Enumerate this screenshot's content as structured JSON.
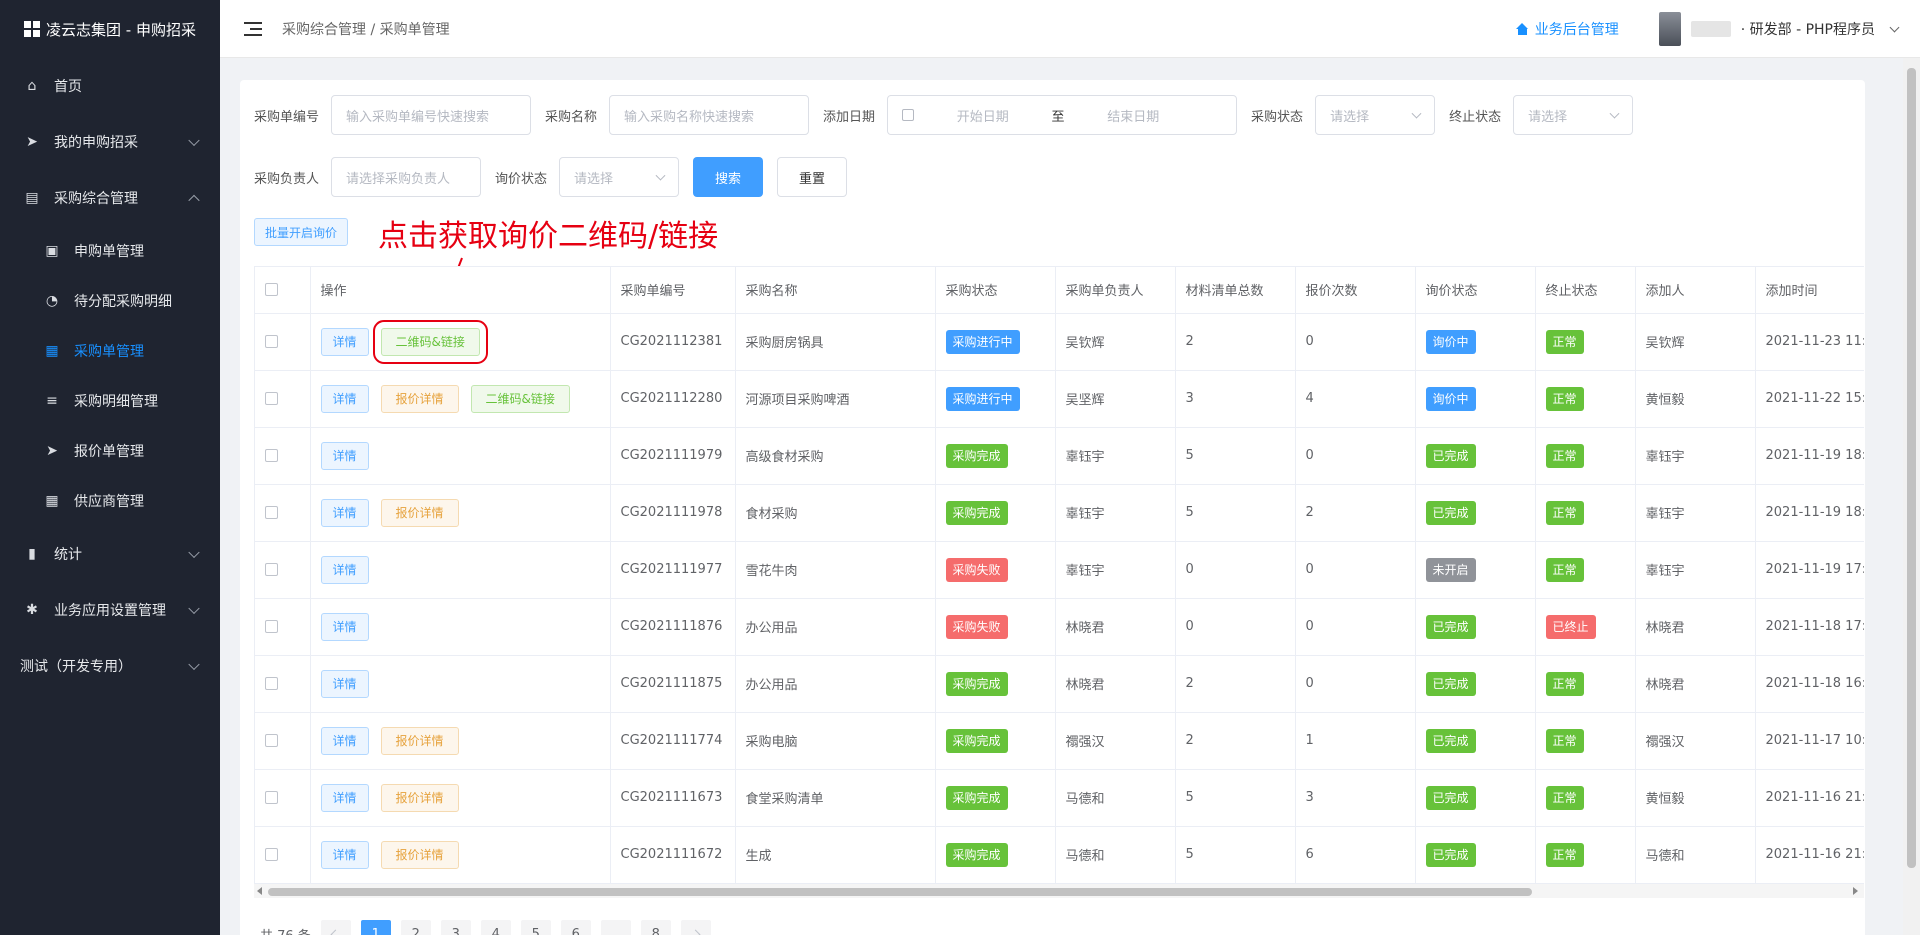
{
  "brand": {
    "title": "凌云志集团 - 申购招采"
  },
  "sidebar": {
    "items": [
      {
        "label": "首页",
        "icon": "home-icon",
        "arrow": ""
      },
      {
        "label": "我的申购招采",
        "icon": "send-icon",
        "arrow": "down"
      },
      {
        "label": "采购综合管理",
        "icon": "chart-icon",
        "arrow": "up"
      }
    ],
    "submenu": [
      {
        "label": "申购单管理",
        "icon": "clipboard-icon",
        "active": false
      },
      {
        "label": "待分配采购明细",
        "icon": "clock-icon",
        "active": false
      },
      {
        "label": "采购单管理",
        "icon": "document-icon",
        "active": true
      },
      {
        "label": "采购明细管理",
        "icon": "sliders-icon",
        "active": false
      },
      {
        "label": "报价单管理",
        "icon": "send-icon",
        "active": false
      },
      {
        "label": "供应商管理",
        "icon": "grid-icon",
        "active": false
      }
    ],
    "items2": [
      {
        "label": "统计",
        "icon": "bar-chart-icon"
      },
      {
        "label": "业务应用设置管理",
        "icon": "gear-icon"
      },
      {
        "label": "测试（开发专用）",
        "icon": ""
      }
    ]
  },
  "header": {
    "breadcrumb": "采购综合管理 / 采购单管理",
    "biz_link": "业务后台管理",
    "user_text": "· 研发部 - PHP程序员"
  },
  "filters": {
    "order_no_label": "采购单编号",
    "order_no_placeholder": "输入采购单编号快速搜索",
    "name_label": "采购名称",
    "name_placeholder": "输入采购名称快速搜索",
    "date_label": "添加日期",
    "date_start": "开始日期",
    "date_sep": "至",
    "date_end": "结束日期",
    "status_label": "采购状态",
    "status_placeholder": "请选择",
    "terminate_label": "终止状态",
    "terminate_placeholder": "请选择",
    "owner_label": "采购负责人",
    "owner_placeholder": "请选择采购负责人",
    "inquiry_label": "询价状态",
    "inquiry_placeholder": "请选择",
    "search_btn": "搜索",
    "reset_btn": "重置",
    "batch_btn": "批量开启询价"
  },
  "annotation": "点击获取询价二维码/链接",
  "table": {
    "headers": [
      "操作",
      "采购单编号",
      "采购名称",
      "采购状态",
      "采购单负责人",
      "材料清单总数",
      "报价次数",
      "询价状态",
      "终止状态",
      "添加人",
      "添加时间"
    ],
    "action_labels": {
      "detail": "详情",
      "quote": "报价详情",
      "qr": "二维码&链接"
    },
    "rows": [
      {
        "actions": [
          "detail",
          "qr"
        ],
        "no": "CG2021112381",
        "name": "采购厨房锅具",
        "status": "采购进行中",
        "status_color": "blue",
        "owner": "吴钦辉",
        "materials": "2",
        "quotes": "0",
        "inquiry": "询价中",
        "inquiry_color": "blue",
        "terminate": "正常",
        "terminate_color": "green",
        "adder": "吴钦辉",
        "time": "2021-11-23 11:"
      },
      {
        "actions": [
          "detail",
          "quote",
          "qr"
        ],
        "no": "CG2021112280",
        "name": "河源项目采购啤酒",
        "status": "采购进行中",
        "status_color": "blue",
        "owner": "吴坚辉",
        "materials": "3",
        "quotes": "4",
        "inquiry": "询价中",
        "inquiry_color": "blue",
        "terminate": "正常",
        "terminate_color": "green",
        "adder": "黄恒毅",
        "time": "2021-11-22 15:"
      },
      {
        "actions": [
          "detail"
        ],
        "no": "CG2021111979",
        "name": "高级食材采购",
        "status": "采购完成",
        "status_color": "green",
        "owner": "辜钰宇",
        "materials": "5",
        "quotes": "0",
        "inquiry": "已完成",
        "inquiry_color": "green",
        "terminate": "正常",
        "terminate_color": "green",
        "adder": "辜钰宇",
        "time": "2021-11-19 18:"
      },
      {
        "actions": [
          "detail",
          "quote"
        ],
        "no": "CG2021111978",
        "name": "食材采购",
        "status": "采购完成",
        "status_color": "green",
        "owner": "辜钰宇",
        "materials": "5",
        "quotes": "2",
        "inquiry": "已完成",
        "inquiry_color": "green",
        "terminate": "正常",
        "terminate_color": "green",
        "adder": "辜钰宇",
        "time": "2021-11-19 18:"
      },
      {
        "actions": [
          "detail"
        ],
        "no": "CG2021111977",
        "name": "雪花牛肉",
        "status": "采购失败",
        "status_color": "red",
        "owner": "辜钰宇",
        "materials": "0",
        "quotes": "0",
        "inquiry": "未开启",
        "inquiry_color": "gray",
        "terminate": "正常",
        "terminate_color": "green",
        "adder": "辜钰宇",
        "time": "2021-11-19 17:"
      },
      {
        "actions": [
          "detail"
        ],
        "no": "CG2021111876",
        "name": "办公用品",
        "status": "采购失败",
        "status_color": "red",
        "owner": "林晓君",
        "materials": "0",
        "quotes": "0",
        "inquiry": "已完成",
        "inquiry_color": "green",
        "terminate": "已终止",
        "terminate_color": "red",
        "adder": "林晓君",
        "time": "2021-11-18 17:"
      },
      {
        "actions": [
          "detail"
        ],
        "no": "CG2021111875",
        "name": "办公用品",
        "status": "采购完成",
        "status_color": "green",
        "owner": "林晓君",
        "materials": "2",
        "quotes": "0",
        "inquiry": "已完成",
        "inquiry_color": "green",
        "terminate": "正常",
        "terminate_color": "green",
        "adder": "林晓君",
        "time": "2021-11-18 16:"
      },
      {
        "actions": [
          "detail",
          "quote"
        ],
        "no": "CG2021111774",
        "name": "采购电脑",
        "status": "采购完成",
        "status_color": "green",
        "owner": "禤强汉",
        "materials": "2",
        "quotes": "1",
        "inquiry": "已完成",
        "inquiry_color": "green",
        "terminate": "正常",
        "terminate_color": "green",
        "adder": "禤强汉",
        "time": "2021-11-17 10:"
      },
      {
        "actions": [
          "detail",
          "quote"
        ],
        "no": "CG2021111673",
        "name": "食堂采购清单",
        "status": "采购完成",
        "status_color": "green",
        "owner": "马德和",
        "materials": "5",
        "quotes": "3",
        "inquiry": "已完成",
        "inquiry_color": "green",
        "terminate": "正常",
        "terminate_color": "green",
        "adder": "黄恒毅",
        "time": "2021-11-16 21:"
      },
      {
        "actions": [
          "detail",
          "quote"
        ],
        "no": "CG2021111672",
        "name": "生成",
        "status": "采购完成",
        "status_color": "green",
        "owner": "马德和",
        "materials": "5",
        "quotes": "6",
        "inquiry": "已完成",
        "inquiry_color": "green",
        "terminate": "正常",
        "terminate_color": "green",
        "adder": "马德和",
        "time": "2021-11-16 21:"
      }
    ]
  },
  "pagination": {
    "total": "共 76 条",
    "pages": [
      "1",
      "2",
      "3",
      "4",
      "5",
      "6",
      "...",
      "8"
    ],
    "active": "1"
  }
}
